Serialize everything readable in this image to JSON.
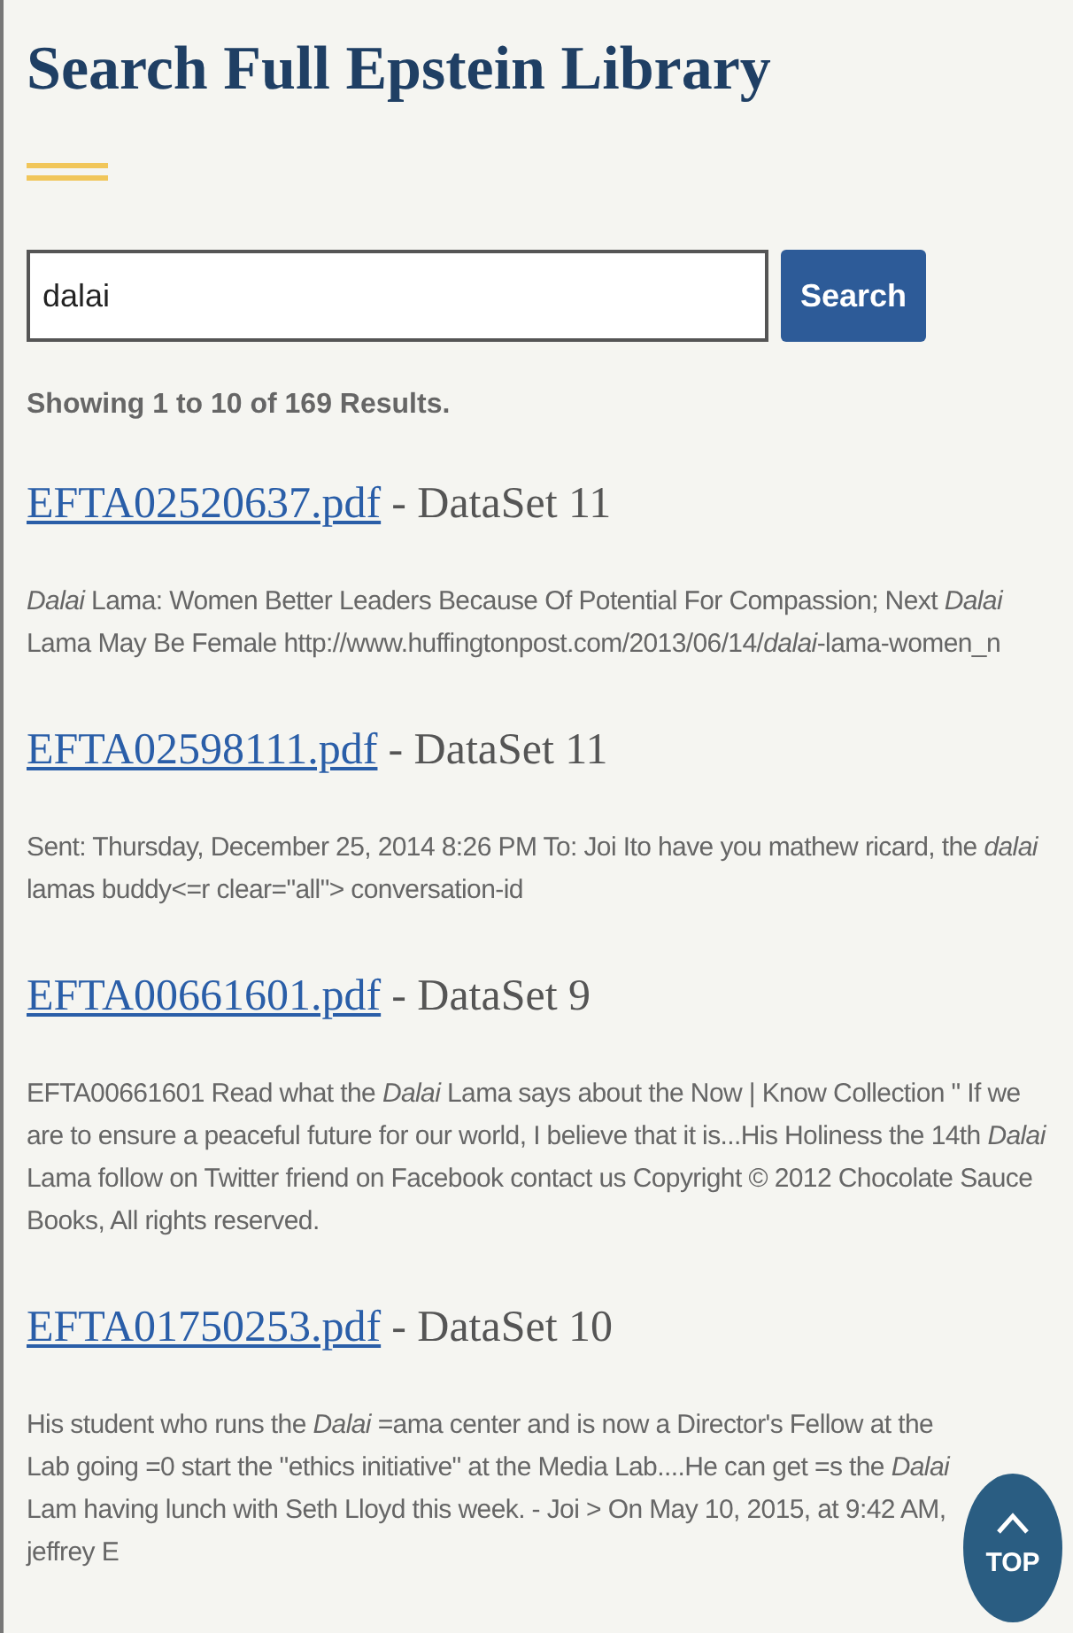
{
  "title": "Search Full Epstein Library",
  "search": {
    "value": "dalai",
    "button": "Search"
  },
  "summary": "Showing 1 to 10 of 169 Results.",
  "results": [
    {
      "file": "EFTA02520637.pdf",
      "dataset": "- DataSet 11",
      "snippet": "*Dalai* Lama: Women Better Leaders Because Of Potential For Compassion; Next *Dalai* Lama May Be Female http://www.huffingtonpost.com/2013/06/14/*dalai*-lama-women_n"
    },
    {
      "file": "EFTA02598111.pdf",
      "dataset": "- DataSet 11",
      "snippet": "Sent: Thursday, December 25, 2014 8:26 PM To: Joi Ito have you mathew ricard, the *dalai* lamas buddy<=r clear=\"all\"> conversation-id"
    },
    {
      "file": "EFTA00661601.pdf",
      "dataset": "- DataSet 9",
      "snippet": "EFTA00661601 Read what the *Dalai* Lama says about the Now | Know Collection \" If we are to ensure a peaceful future for our world, I believe that it is...His Holiness the 14th *Dalai* Lama follow on Twitter friend on Facebook contact us Copyright © 2012 Chocolate Sauce Books, All rights reserved."
    },
    {
      "file": "EFTA01750253.pdf",
      "dataset": "- DataSet 10",
      "snippet": "His student who runs the *Dalai* =ama center and is now a Director's Fellow at the Lab going =0 start the \"ethics initiative\" at the Media Lab....He can get =s the *Dalai* Lam having lunch with Seth Lloyd this week. - Joi > On May 10, 2015, at 9:42 AM, jeffrey E"
    }
  ],
  "top_button": {
    "label": "TOP"
  }
}
